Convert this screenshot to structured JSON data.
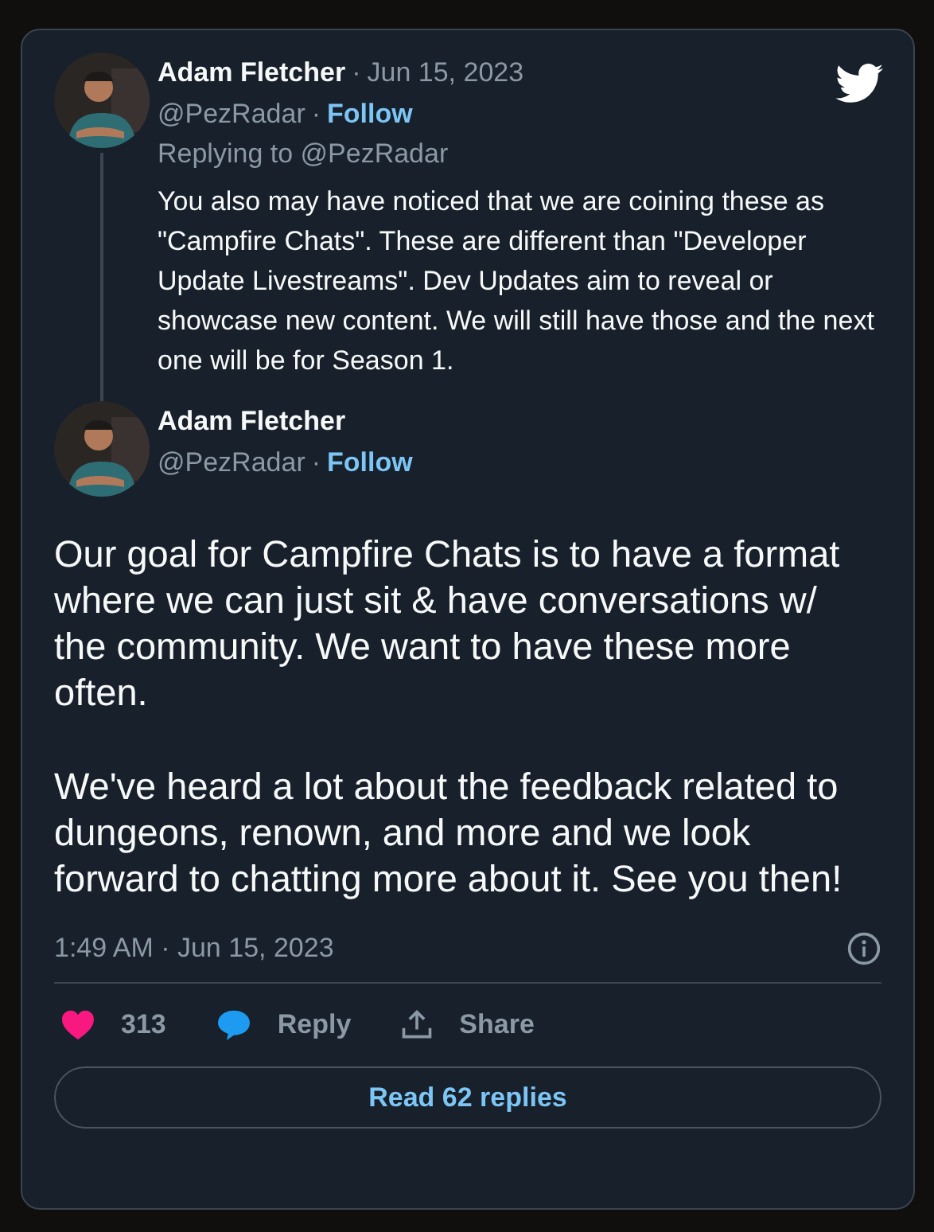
{
  "parent_tweet": {
    "name": "Adam Fletcher",
    "separator_1": "·",
    "date": "Jun 15, 2023",
    "handle": "@PezRadar",
    "separator_2": "·",
    "follow": "Follow",
    "replying_to": "Replying to @PezRadar",
    "text": "You also may have noticed that we are coining these as \"Campfire Chats\". These are different than \"Developer Update Livestreams\". Dev Updates aim to reveal or showcase new content. We will still have those and the next one will be for Season 1."
  },
  "main_tweet": {
    "name": "Adam Fletcher",
    "handle": "@PezRadar",
    "separator": "·",
    "follow": "Follow",
    "paragraphs": [
      "Our goal for Campfire Chats is to have a format where we can just sit & have conversations w/ the community. We want to have these more often.",
      "We've heard a lot about the feedback related to dungeons, renown, and more and we look forward to chatting more about it. See you then!"
    ],
    "timestamp": "1:49 AM · Jun 15, 2023"
  },
  "actions": {
    "likes": "313",
    "reply": "Reply",
    "share": "Share"
  },
  "read_replies": "Read 62 replies"
}
